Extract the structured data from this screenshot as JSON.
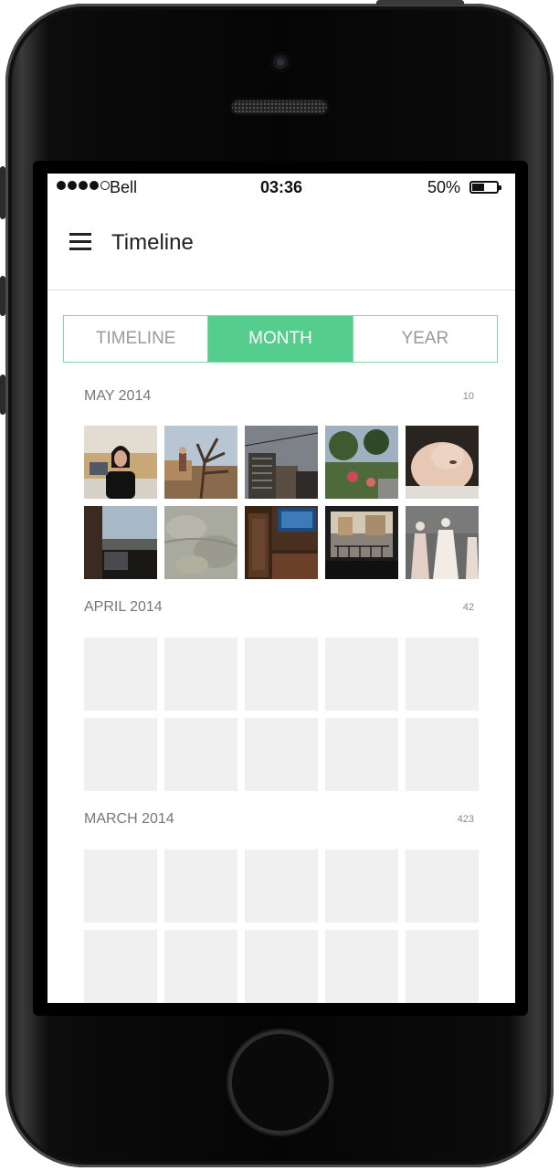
{
  "status_bar": {
    "carrier": "Bell",
    "time": "03:36",
    "battery_percent": "50%",
    "battery_level": 0.5,
    "signal_bars_filled": 4,
    "signal_bars_total": 5
  },
  "app_bar": {
    "title": "Timeline",
    "menu_icon": "hamburger-menu-icon"
  },
  "segmented_control": {
    "tabs": [
      {
        "label": "TIMELINE",
        "active": false
      },
      {
        "label": "MONTH",
        "active": true
      },
      {
        "label": "YEAR",
        "active": false
      }
    ]
  },
  "sections": [
    {
      "label": "MAY 2014",
      "count": "10",
      "photos_loaded": true,
      "photos": [
        "person-at-desk",
        "man-with-tree",
        "city-buildings",
        "garden-flowers",
        "sleeping-dog",
        "laptop-by-window",
        "blurry-ground",
        "tv-in-room",
        "street-scene",
        "mannequins"
      ]
    },
    {
      "label": "APRIL 2014",
      "count": "42",
      "photos_loaded": false
    },
    {
      "label": "MARCH 2014",
      "count": "423",
      "photos_loaded": false
    }
  ],
  "colors": {
    "accent": "#55cd8c",
    "accent_border": "#7fd9a9",
    "placeholder": "#f0f0f0"
  }
}
